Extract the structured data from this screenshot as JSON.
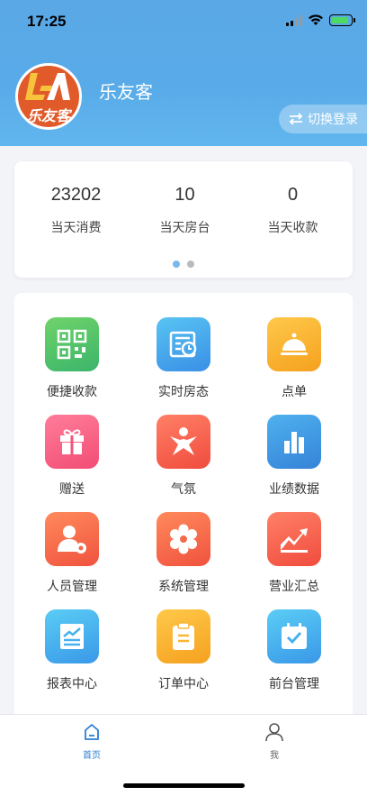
{
  "status_bar": {
    "time": "17:25"
  },
  "header": {
    "logo_text": "乐友客",
    "shop_name": "乐友客",
    "switch_label": "切换登录",
    "switch_icon": "swap-arrows-icon"
  },
  "stats": {
    "items": [
      {
        "value": "23202",
        "label": "当天消费"
      },
      {
        "value": "10",
        "label": "当天房台"
      },
      {
        "value": "0",
        "label": "当天收款"
      }
    ]
  },
  "menu": {
    "items": [
      {
        "label": "便捷收款",
        "icon": "qr-code-icon",
        "color": "#4cc46a"
      },
      {
        "label": "实时房态",
        "icon": "room-clock-icon",
        "color": "#45a9ee"
      },
      {
        "label": "点单",
        "icon": "cloche-icon",
        "color": "#f8b633"
      },
      {
        "label": "赠送",
        "icon": "gift-icon",
        "color": "#f8607f"
      },
      {
        "label": "气氛",
        "icon": "party-person-icon",
        "color": "#f76050"
      },
      {
        "label": "业绩数据",
        "icon": "bar-chart-icon",
        "color": "#409ae6"
      },
      {
        "label": "人员管理",
        "icon": "user-gear-icon",
        "color": "#f86e50"
      },
      {
        "label": "系统管理",
        "icon": "gear-icon",
        "color": "#f66a52"
      },
      {
        "label": "营业汇总",
        "icon": "trend-up-icon",
        "color": "#f65a48"
      },
      {
        "label": "报表中心",
        "icon": "report-chart-icon",
        "color": "#48b1f0"
      },
      {
        "label": "订单中心",
        "icon": "clipboard-icon",
        "color": "#f8b633"
      },
      {
        "label": "前台管理",
        "icon": "calendar-check-icon",
        "color": "#48b1f0"
      }
    ]
  },
  "tabbar": {
    "tabs": [
      {
        "label": "首页",
        "icon": "home-icon",
        "active": true
      },
      {
        "label": "我",
        "icon": "person-icon",
        "active": false
      }
    ],
    "active_color": "#2b7fd4"
  }
}
